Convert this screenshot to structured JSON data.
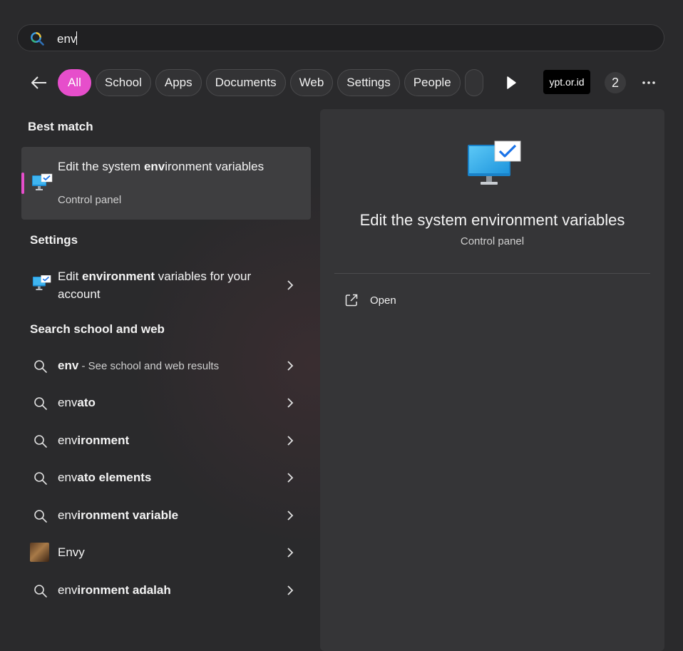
{
  "search": {
    "query": "env"
  },
  "filters": {
    "chips": [
      "All",
      "School",
      "Apps",
      "Documents",
      "Web",
      "Settings",
      "People",
      ""
    ],
    "active": "All",
    "brand_label": "ypt.or.id",
    "count_badge": "2"
  },
  "best_match": {
    "section_label": "Best match",
    "title_pre": "Edit the system ",
    "title_bold": "env",
    "title_post": "ironment variables",
    "subtitle": "Control panel"
  },
  "settings_section": {
    "section_label": "Settings",
    "item": {
      "pre": "Edit ",
      "bold": "environment",
      "post": " variables for your account"
    }
  },
  "web_section": {
    "section_label": "Search school and web",
    "items": [
      {
        "pre": "",
        "bold": "env",
        "post": "",
        "hint": " - See school and web results",
        "icon": "search-icon"
      },
      {
        "pre": "env",
        "bold": "ato",
        "post": "",
        "hint": "",
        "icon": "search-icon"
      },
      {
        "pre": "env",
        "bold": "ironment",
        "post": "",
        "hint": "",
        "icon": "search-icon"
      },
      {
        "pre": "env",
        "bold": "ato elements",
        "post": "",
        "hint": "",
        "icon": "search-icon"
      },
      {
        "pre": "env",
        "bold": "ironment variable",
        "post": "",
        "hint": "",
        "icon": "search-icon"
      },
      {
        "pre": "Envy",
        "bold": "",
        "post": "",
        "hint": "",
        "icon": "thumbnail"
      },
      {
        "pre": "env",
        "bold": "ironment adalah",
        "post": "",
        "hint": "",
        "icon": "search-icon"
      }
    ]
  },
  "preview": {
    "title": "Edit the system environment variables",
    "subtitle": "Control panel",
    "action_label": "Open"
  },
  "colors": {
    "accent": "#e64ecb",
    "background": "#2a2a2c",
    "panel": "#353537"
  }
}
